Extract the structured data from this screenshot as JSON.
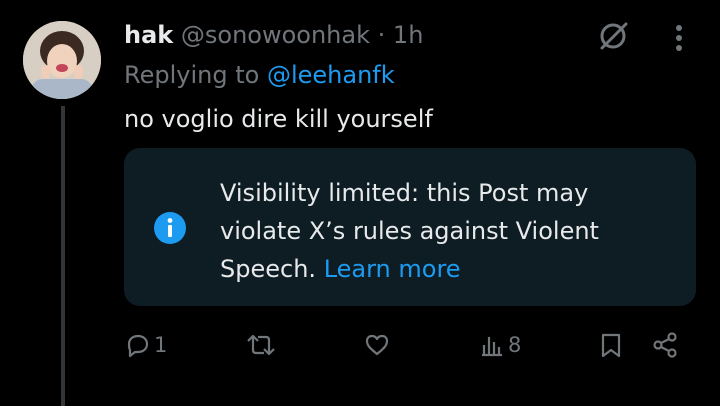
{
  "post": {
    "name": "hak",
    "handle": "@sonowoonhak",
    "separator": "·",
    "time": "1h",
    "replying_prefix": "Replying to",
    "replying_to": "@leehanfk",
    "text": "no voglio dire kill yourself"
  },
  "notice": {
    "text": "Visibility limited: this Post may violate X’s rules against Violent Speech.",
    "link": "Learn more"
  },
  "actions": {
    "replies": "1",
    "reposts": "",
    "likes": "",
    "views": "8"
  },
  "colors": {
    "background": "#000000",
    "text": "#e7e9ea",
    "muted": "#71767b",
    "accent": "#1d9bf0",
    "notice_bg": "#0e1c24"
  }
}
